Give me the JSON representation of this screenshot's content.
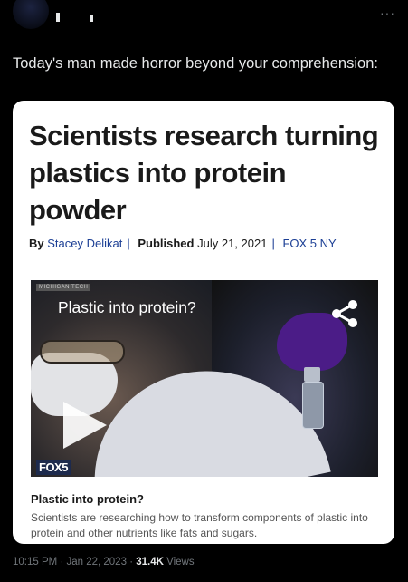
{
  "tweet": {
    "text": "Today's man made horror beyond your comprehension:",
    "more_icon": "···"
  },
  "article": {
    "headline": "Scientists research turning plastics into protein powder",
    "byline": {
      "by_label": "By",
      "author": "Stacey Delikat",
      "published_label": "Published",
      "date": "July 21, 2021",
      "outlet": "FOX 5 NY"
    },
    "video": {
      "source_tag": "MICHIGAN TECH",
      "overlay_title": "Plastic into protein?",
      "logo": "FOX5",
      "share_icon": "share-icon",
      "play_icon": "play-icon"
    },
    "caption": {
      "title": "Plastic into protein?",
      "text": "Scientists are researching how to transform components of plastic into protein and other nutrients like fats and sugars."
    }
  },
  "meta": {
    "time": "10:15 PM",
    "date": "Jan 22, 2023",
    "views": "31.4K",
    "views_label": "Views"
  },
  "colors": {
    "background": "#000000",
    "card": "#ffffff",
    "link": "#1c3f95",
    "glove": "#4b1c87"
  }
}
